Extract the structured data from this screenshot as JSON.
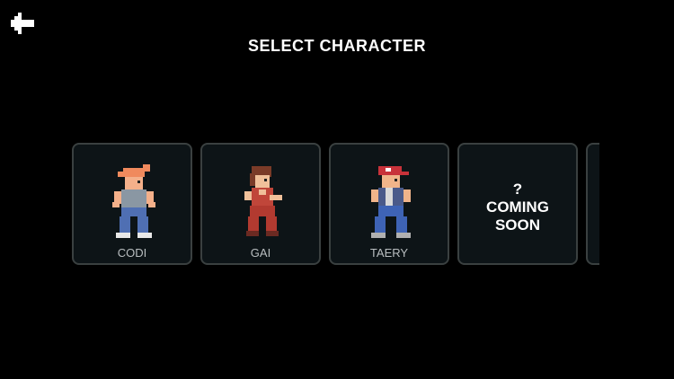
{
  "header": {
    "title": "SELECT CHARACTER",
    "back_icon": "back-arrow-icon"
  },
  "characters": [
    {
      "name": "CODI",
      "hair": "#f08a5d",
      "top": "#8a97a3",
      "pants": "#4f6fb3"
    },
    {
      "name": "GAI",
      "hair": "#7a3b28",
      "top": "#c0463a",
      "pants": "#b23a30"
    },
    {
      "name": "TAERY",
      "hair": "#c8323a",
      "top": "#4a5a8a",
      "pants": "#3e63b5"
    }
  ],
  "coming_soon": {
    "mark": "?",
    "line1": "COMING",
    "line2": "SOON"
  },
  "colors": {
    "background": "#000000",
    "card_bg": "#0d1417",
    "card_border": "#3a4040",
    "label": "#b9bec0"
  }
}
